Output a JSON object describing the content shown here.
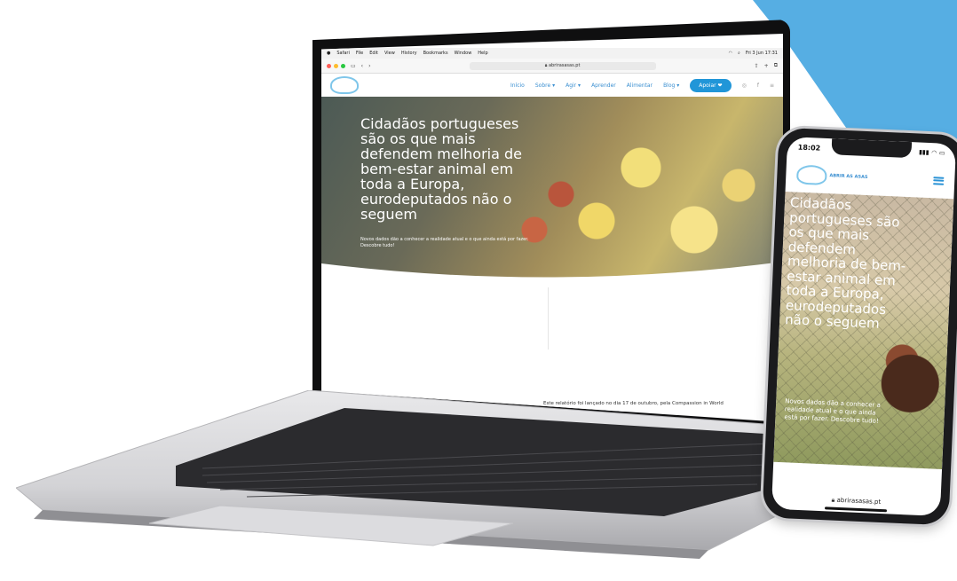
{
  "laptop": {
    "menubar": {
      "items": [
        "Safari",
        "File",
        "Edit",
        "View",
        "History",
        "Bookmarks",
        "Window",
        "Help"
      ],
      "clock": "Fri 3 Jun 17:31"
    },
    "browser": {
      "url": "abrirasasas.pt"
    },
    "site": {
      "nav": [
        "Início",
        "Sobre ▾",
        "Agir ▾",
        "Aprender",
        "Alimentar",
        "Blog ▾"
      ],
      "apoiar_label": "Apoiar ❤",
      "hero_title": "Cidadãos portugueses são os que mais defendem melhoria de bem-estar animal em toda a Europa, eurodeputados não o seguem",
      "hero_subtitle": "Novos dados dão a conhecer a realidade atual e o que ainda está por fazer. Descobre tudo!",
      "footer_text": "Este relatório foi lançado no dia 17 de outubro, pela Compassion in World"
    }
  },
  "phone": {
    "time": "18:02",
    "logo_text": "ABRIR AS ASAS",
    "hero_title": "Cidadãos portugueses são os que mais defendem melhoria de bem-estar animal em toda a Europa, eurodeputados não o seguem",
    "hero_subtitle": "Novos dados dão a conhecer a realidade atual e o que ainda está por fazer. Descobre tudo!",
    "url": "abrirasasas.pt"
  },
  "colors": {
    "accent_blue": "#2196d8",
    "corner_blue": "#56aee3",
    "logo_blue": "#7fc6ea"
  }
}
